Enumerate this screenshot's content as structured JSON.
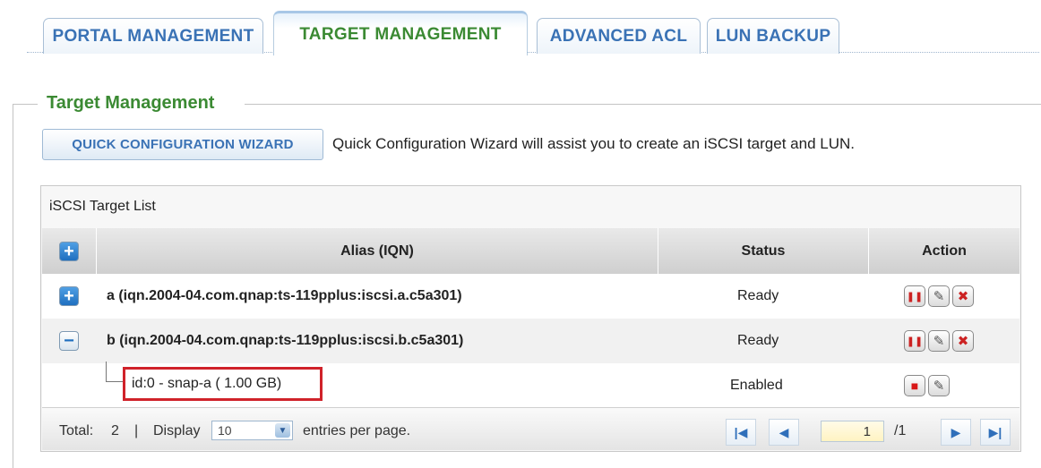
{
  "tabs": [
    {
      "label": "PORTAL MANAGEMENT",
      "active": false
    },
    {
      "label": "TARGET MANAGEMENT",
      "active": true
    },
    {
      "label": "ADVANCED ACL",
      "active": false
    },
    {
      "label": "LUN BACKUP",
      "active": false
    }
  ],
  "section": {
    "legend": "Target Management",
    "wizard_button": "QUICK CONFIGURATION WIZARD",
    "wizard_desc": "Quick Configuration Wizard will assist you to create an iSCSI target and LUN."
  },
  "panel": {
    "title": "iSCSI Target List",
    "headers": {
      "alias": "Alias (IQN)",
      "status": "Status",
      "action": "Action"
    },
    "rows": [
      {
        "alias": "a (iqn.2004-04.com.qnap:ts-119pplus:iscsi.a.c5a301)",
        "status": "Ready",
        "expanded": false
      },
      {
        "alias": "b (iqn.2004-04.com.qnap:ts-119pplus:iscsi.b.c5a301)",
        "status": "Ready",
        "expanded": true
      },
      {
        "alias": "id:0 - snap-a ( 1.00 GB)",
        "status": "Enabled",
        "child": true
      }
    ]
  },
  "footer": {
    "total_label": "Total:",
    "total_value": "2",
    "separator": "|",
    "display_label": "Display",
    "display_value": "10",
    "entries_label": "entries per page.",
    "page_current": "1",
    "page_total": "/1"
  },
  "icons": {
    "expand": "+",
    "collapse": "−",
    "pause": "❚❚",
    "edit": "✎",
    "delete": "✖",
    "stop": "■",
    "first": "|◀",
    "prev": "◀",
    "next": "▶",
    "last": "▶|",
    "dropdown": "▼"
  },
  "colors": {
    "tab_text": "#3a72b5",
    "active_tab_text": "#3b8a33",
    "highlight_box": "#d0222a",
    "danger_icon": "#cc2222"
  }
}
